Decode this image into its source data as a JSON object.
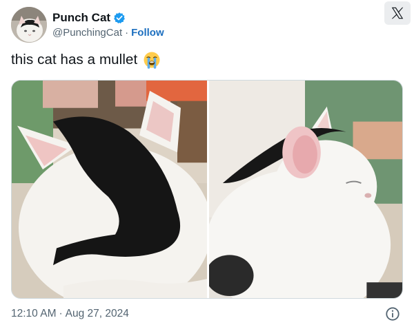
{
  "author": {
    "display_name": "Punch Cat",
    "handle": "@PunchingCat",
    "separator": "·",
    "follow_label": "Follow",
    "verified_icon": "verified-badge-icon",
    "verified_color": "#1d9bf0"
  },
  "platform": {
    "logo_icon": "x-logo-icon"
  },
  "tweet": {
    "text": "this cat has a mullet",
    "emoji": "😭",
    "emoji_icon": "loudly-crying-face-icon"
  },
  "media": {
    "photos": [
      {
        "subject": "cat-back-of-head-photo"
      },
      {
        "subject": "cat-side-profile-photo"
      }
    ]
  },
  "footer": {
    "time": "12:10 AM",
    "separator": "·",
    "date": "Aug 27, 2024",
    "info_icon": "info-icon"
  },
  "colors": {
    "text_primary": "#0f1419",
    "text_secondary": "#536471",
    "link": "#1d6fbf",
    "border": "#cfd9de"
  }
}
